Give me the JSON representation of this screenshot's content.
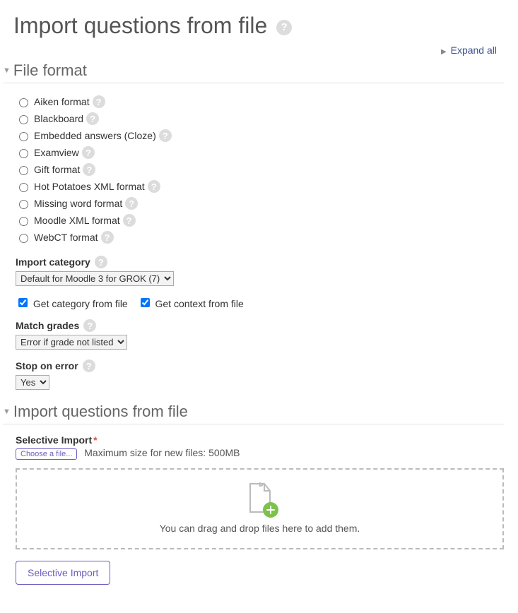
{
  "page": {
    "title": "Import questions from file",
    "expand_all": "Expand all"
  },
  "sections": {
    "file_format": {
      "title": "File format",
      "formats": [
        "Aiken format",
        "Blackboard",
        "Embedded answers (Cloze)",
        "Examview",
        "Gift format",
        "Hot Potatoes XML format",
        "Missing word format",
        "Moodle XML format",
        "WebCT format"
      ],
      "import_category": {
        "label": "Import category",
        "selected": "Default for Moodle 3 for GROK (7)"
      },
      "get_category_from_file": "Get category from file",
      "get_context_from_file": "Get context from file",
      "match_grades": {
        "label": "Match grades",
        "selected": "Error if grade not listed"
      },
      "stop_on_error": {
        "label": "Stop on error",
        "selected": "Yes"
      }
    },
    "import_from_file": {
      "title": "Import questions from file",
      "selective_import_label": "Selective Import",
      "choose_file": "Choose a file...",
      "max_size": "Maximum size for new files: 500MB",
      "drop_hint": "You can drag and drop files here to add them.",
      "submit": "Selective Import"
    }
  }
}
